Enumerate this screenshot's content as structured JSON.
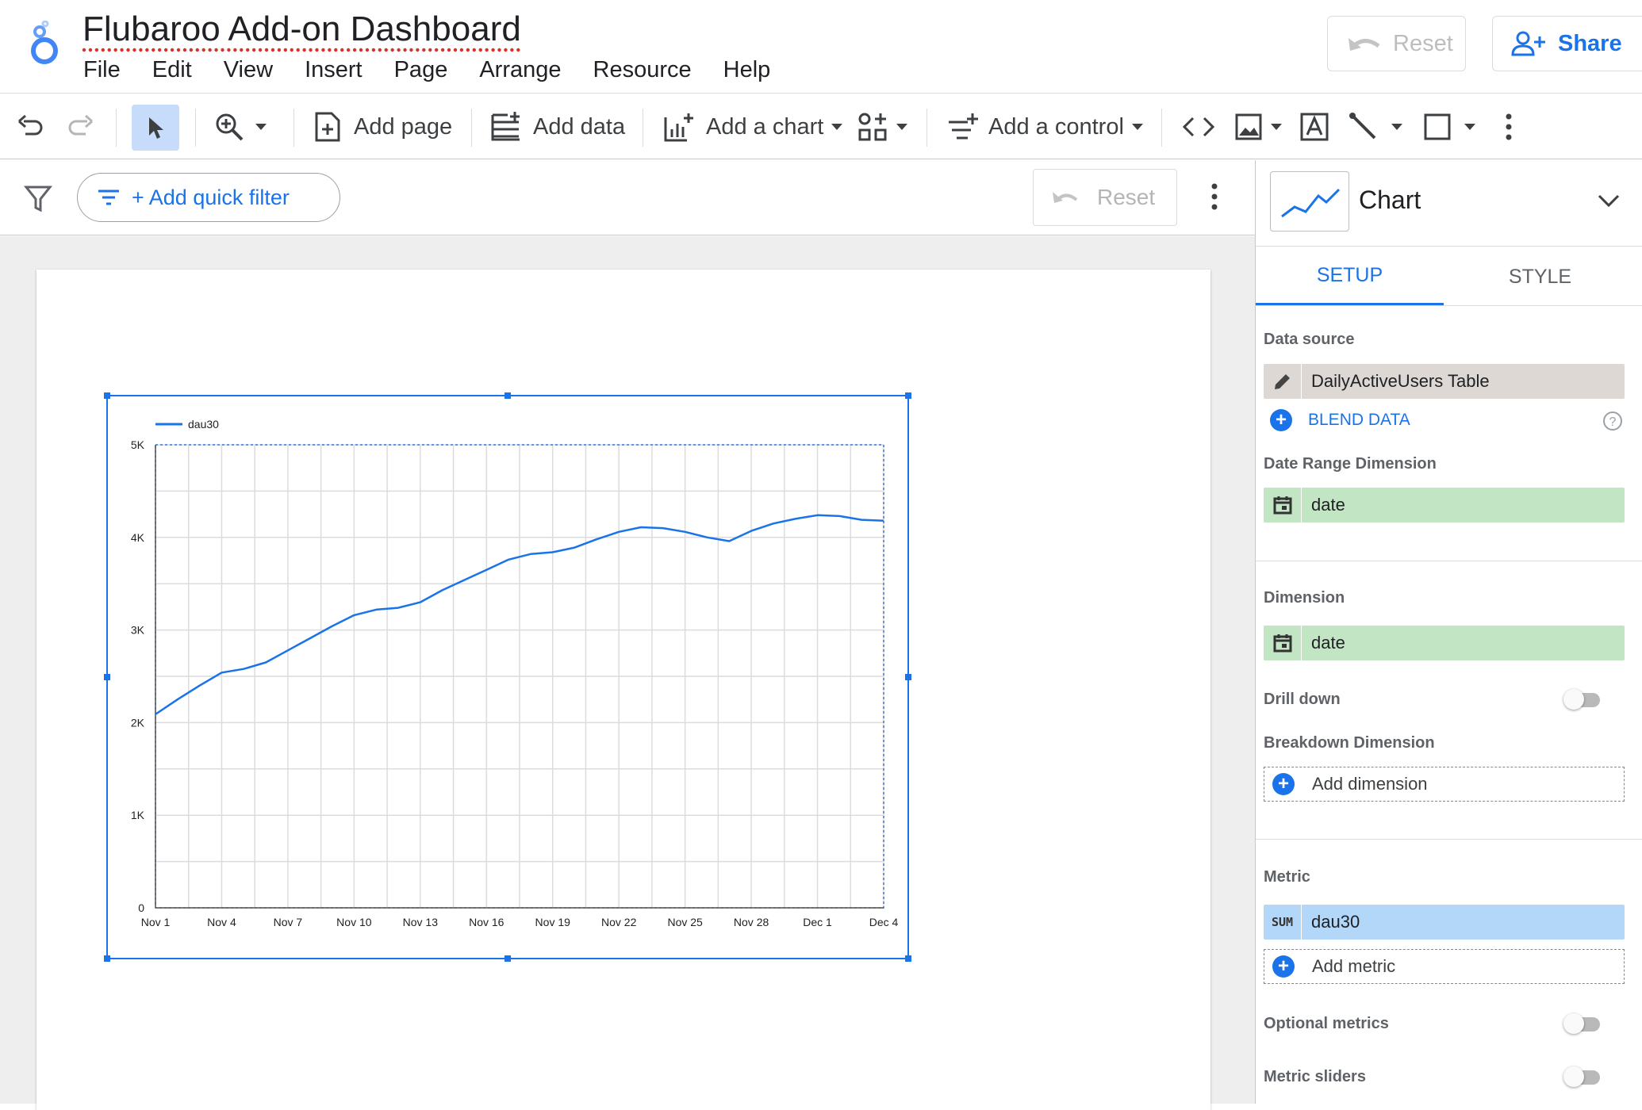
{
  "app": {
    "title": "Flubaroo Add-on Dashboard",
    "menu": [
      "File",
      "Edit",
      "View",
      "Insert",
      "Page",
      "Arrange",
      "Resource",
      "Help"
    ],
    "reset_label": "Reset",
    "share_label": "Share"
  },
  "toolbar": {
    "add_page": "Add page",
    "add_data": "Add data",
    "add_chart": "Add a chart",
    "add_control": "Add a control"
  },
  "filterbar": {
    "add_filter": "+ Add quick filter",
    "reset_label": "Reset"
  },
  "panel": {
    "chart_type": "Chart",
    "tabs": [
      "SETUP",
      "STYLE"
    ],
    "data_source_label": "Data source",
    "data_source_value": "DailyActiveUsers Table",
    "blend_data": "BLEND DATA",
    "date_range_label": "Date Range Dimension",
    "date_range_value": "date",
    "dimension_label": "Dimension",
    "dimension_value": "date",
    "drill_down_label": "Drill down",
    "breakdown_label": "Breakdown Dimension",
    "add_dimension": "Add dimension",
    "metric_label": "Metric",
    "metric_agg": "SUM",
    "metric_value": "dau30",
    "add_metric": "Add metric",
    "optional_metrics_label": "Optional metrics",
    "metric_sliders_label": "Metric sliders"
  },
  "colors": {
    "accent": "#1a73e8",
    "line": "#1a73e8",
    "data_source_bg": "#ddd8d4",
    "dimension_bg": "#c2e5c4",
    "metric_bg": "#b3d7f8"
  },
  "chart_data": {
    "type": "line",
    "legend": "dau30",
    "x": [
      "Nov 1",
      "Nov 2",
      "Nov 3",
      "Nov 4",
      "Nov 5",
      "Nov 6",
      "Nov 7",
      "Nov 8",
      "Nov 9",
      "Nov 10",
      "Nov 11",
      "Nov 12",
      "Nov 13",
      "Nov 14",
      "Nov 15",
      "Nov 16",
      "Nov 17",
      "Nov 18",
      "Nov 19",
      "Nov 20",
      "Nov 21",
      "Nov 22",
      "Nov 23",
      "Nov 24",
      "Nov 25",
      "Nov 26",
      "Nov 27",
      "Nov 28",
      "Nov 29",
      "Nov 30",
      "Dec 1",
      "Dec 2",
      "Dec 3",
      "Dec 4"
    ],
    "xticks": [
      "Nov 1",
      "Nov 4",
      "Nov 7",
      "Nov 10",
      "Nov 13",
      "Nov 16",
      "Nov 19",
      "Nov 22",
      "Nov 25",
      "Nov 28",
      "Dec 1",
      "Dec 4"
    ],
    "series": [
      {
        "name": "dau30",
        "values": [
          2090,
          2250,
          2400,
          2540,
          2580,
          2650,
          2780,
          2910,
          3040,
          3160,
          3220,
          3240,
          3300,
          3430,
          3540,
          3650,
          3760,
          3820,
          3840,
          3890,
          3980,
          4060,
          4110,
          4100,
          4060,
          4000,
          3960,
          4070,
          4150,
          4200,
          4240,
          4230,
          4190,
          4180
        ]
      }
    ],
    "yticks": [
      "0",
      "1K",
      "2K",
      "3K",
      "4K",
      "5K"
    ],
    "ylim": [
      0,
      5000
    ],
    "grid": true,
    "legend_position": "top-left"
  }
}
